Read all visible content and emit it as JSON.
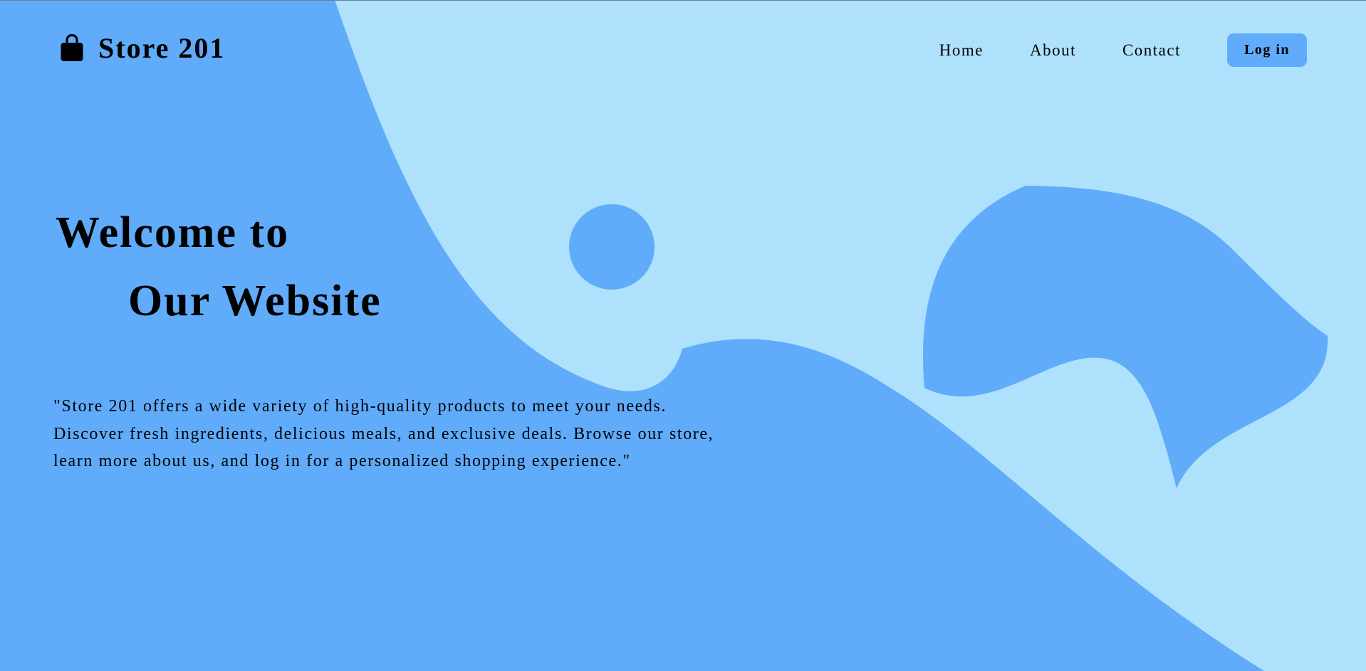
{
  "brand": {
    "icon": "shopping-bag-icon",
    "name": "Store 201"
  },
  "nav": {
    "links": [
      "Home",
      "About",
      "Contact"
    ],
    "login_label": "Log in"
  },
  "hero": {
    "title_line1": "Welcome to",
    "title_line2": "Our Website",
    "description": "\"Store 201 offers a wide variety of high-quality products to meet your needs. Discover fresh ingredients, delicious meals, and exclusive deals. Browse our store, learn more about us, and log in for a personalized shopping experience.\""
  },
  "colors": {
    "background_light": "#aee1fc",
    "shape_blue": "#60abfa",
    "text": "#000000"
  }
}
